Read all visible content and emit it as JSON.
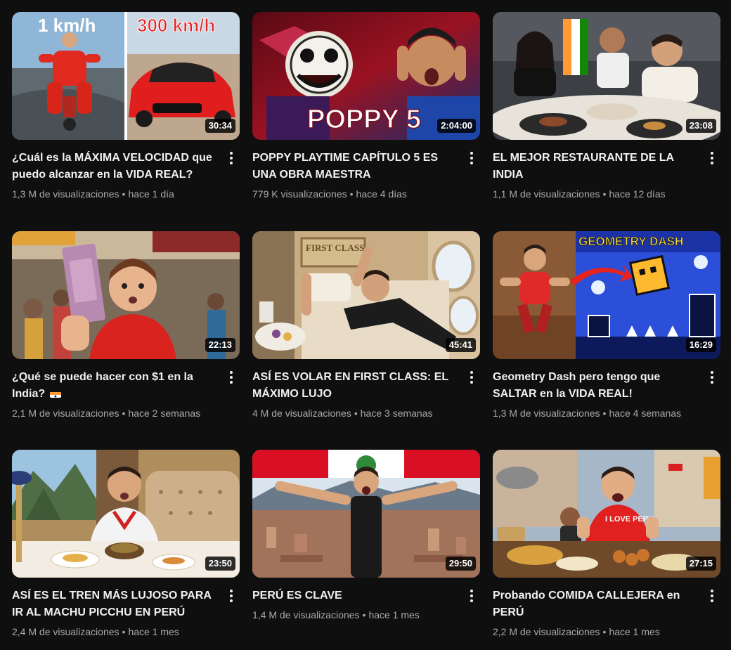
{
  "videos": [
    {
      "title": "¿Cuál es la MÁXIMA VELOCIDAD que puedo alcanzar en la VIDA REAL?",
      "duration": "30:34",
      "views": "1,3 M de visualizaciones",
      "age": "hace 1 día",
      "thumb_text": [
        "1 km/h",
        "300 km/h"
      ]
    },
    {
      "title": "POPPY PLAYTIME CAPÍTULO 5 ES UNA OBRA MAESTRA",
      "duration": "2:04:00",
      "views": "779 K visualizaciones",
      "age": "hace 4 días",
      "thumb_text": [
        "POPPY 5"
      ]
    },
    {
      "title": "EL MEJOR RESTAURANTE DE LA INDIA",
      "duration": "23:08",
      "views": "1,1 M de visualizaciones",
      "age": "hace 12 días"
    },
    {
      "title": "¿Qué se puede hacer con $1 en la India?",
      "duration": "22:13",
      "views": "2,1 M de visualizaciones",
      "age": "hace 2 semanas",
      "title_icon": "india-flag-icon"
    },
    {
      "title": "ASÍ ES VOLAR EN FIRST CLASS: EL MÁXIMO LUJO",
      "duration": "45:41",
      "views": "4 M de visualizaciones",
      "age": "hace 3 semanas",
      "thumb_text": [
        "FIRST CLASS"
      ]
    },
    {
      "title": "Geometry Dash pero tengo que SALTAR en la VIDA REAL!",
      "duration": "16:29",
      "views": "1,3 M de visualizaciones",
      "age": "hace 4 semanas",
      "thumb_text": [
        "GEOMETRY DASH"
      ]
    },
    {
      "title": "ASÍ ES EL TREN MÁS LUJOSO PARA IR AL MACHU PICCHU EN PERÚ",
      "duration": "23:50",
      "views": "2,4 M de visualizaciones",
      "age": "hace 1 mes"
    },
    {
      "title": "PERÚ ES CLAVE",
      "duration": "29:50",
      "views": "1,4 M de visualizaciones",
      "age": "hace 1 mes"
    },
    {
      "title": "Probando COMIDA CALLEJERA en PERÚ",
      "duration": "27:15",
      "views": "2,2 M de visualizaciones",
      "age": "hace 1 mes",
      "thumb_text": [
        "I LOVE PERU"
      ]
    }
  ],
  "separator": "•",
  "colors": {
    "background": "#0f0f0f",
    "title": "#f1f1f1",
    "meta": "#aaaaaa"
  }
}
